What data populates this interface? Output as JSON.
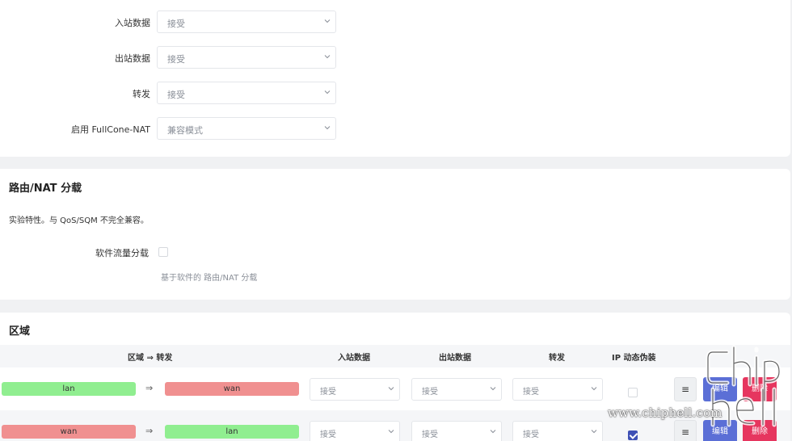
{
  "top_settings": {
    "rows": [
      {
        "label": "入站数据",
        "value": "接受"
      },
      {
        "label": "出站数据",
        "value": "接受"
      },
      {
        "label": "转发",
        "value": "接受"
      },
      {
        "label": "启用 FullCone-NAT",
        "value": "兼容模式"
      }
    ]
  },
  "offload": {
    "title": "路由/NAT 分载",
    "description": "实验特性。与 QoS/SQM 不完全兼容。",
    "checkbox_label": "软件流量分载",
    "checkbox_checked": false,
    "hint": "基于软件的 路由/NAT 分载"
  },
  "zones": {
    "title": "区域",
    "headers": {
      "zone_forward": "区域 ⇒ 转发",
      "input": "入站数据",
      "output": "出站数据",
      "forward": "转发",
      "masquerade": "IP 动态伪装"
    },
    "rows": [
      {
        "zone": "lan",
        "arrow": "⇒",
        "dest": "wan",
        "input": "接受",
        "output": "接受",
        "forward": "接受",
        "masquerade": false,
        "menu": "≡",
        "edit": "编辑",
        "delete": "删除"
      },
      {
        "zone": "wan",
        "arrow": "⇒",
        "dest": "lan",
        "input": "接受",
        "output": "接受",
        "forward": "接受",
        "masquerade": true,
        "menu": "≡",
        "edit": "编辑",
        "delete": "删除"
      }
    ],
    "colors": {
      "lan": "#90ee90",
      "wan": "#f09090"
    }
  },
  "watermark": {
    "text": "www.chiphell.com"
  }
}
